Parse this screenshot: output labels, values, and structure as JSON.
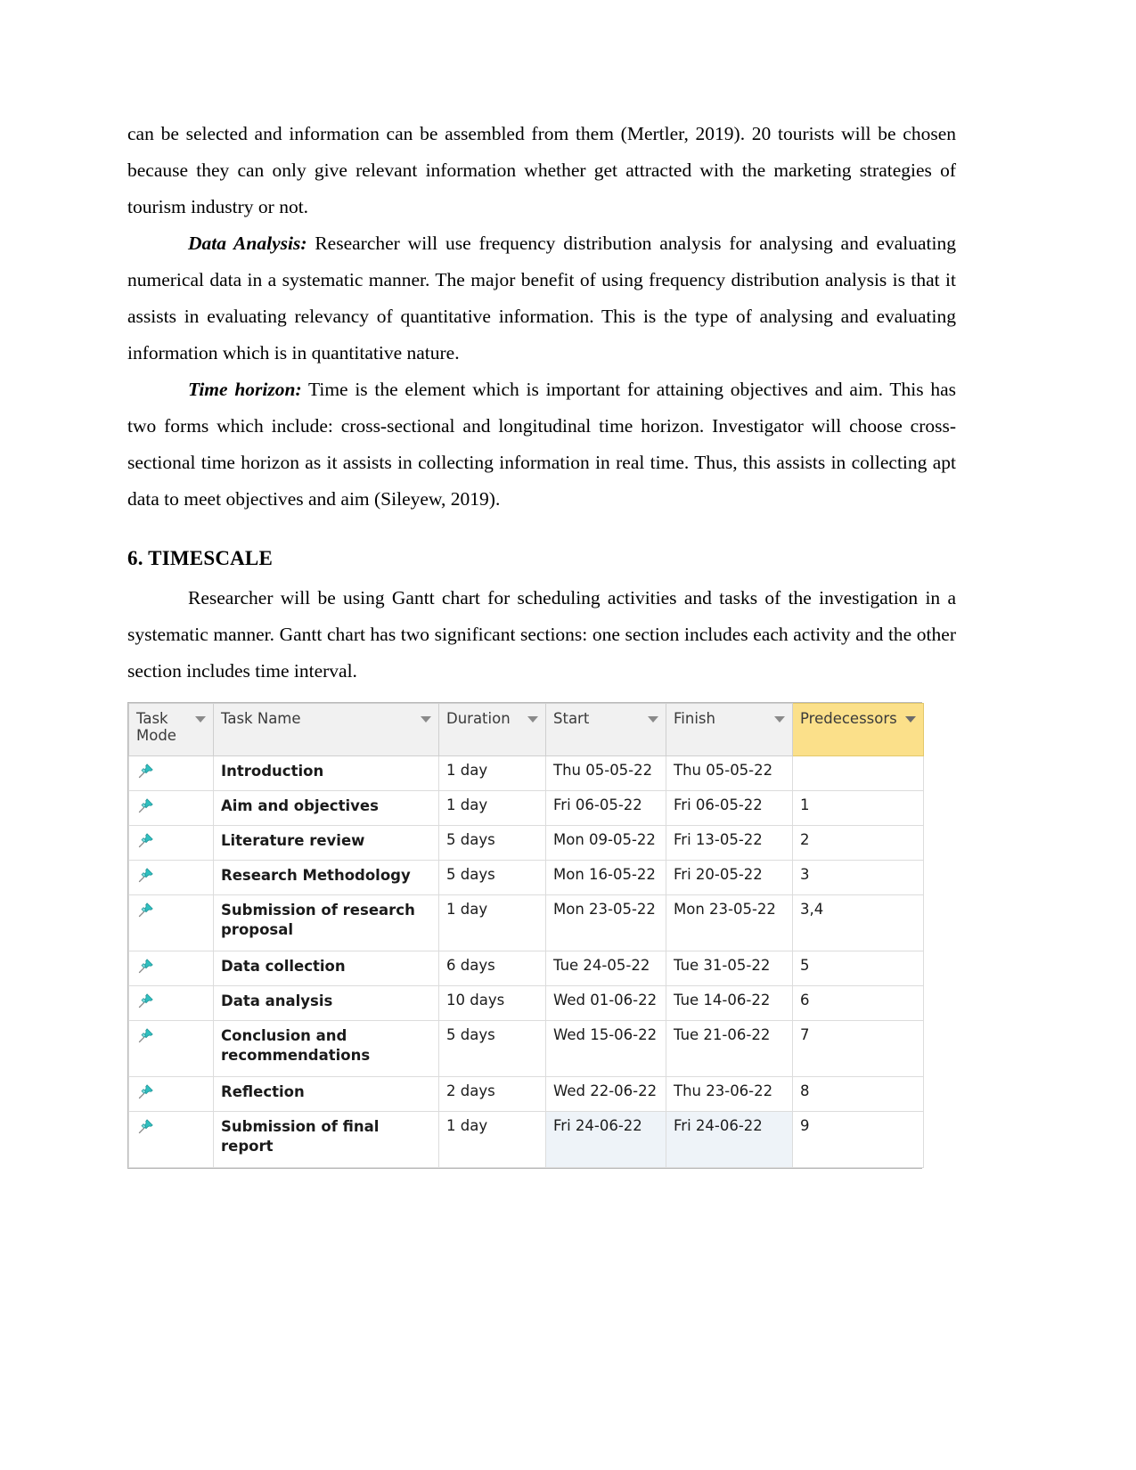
{
  "document": {
    "paragraphs": [
      {
        "id": "p1",
        "text": "can be selected and information can be assembled from them (Mertler, 2019). 20 tourists will be chosen because they can only give relevant information whether get attracted with the marketing strategies of tourism industry or not."
      },
      {
        "id": "p2",
        "lead": "Data Analysis:",
        "text": " Researcher will use frequency distribution analysis for analysing and evaluating numerical data in a systematic manner. The major benefit of using frequency distribution analysis is that it assists in evaluating relevancy of quantitative information. This is the type of analysing and evaluating information which is in quantitative nature."
      },
      {
        "id": "p3",
        "lead": "Time horizon:",
        "text": " Time is the element which is important for attaining objectives and aim. This has two forms which include: cross-sectional and longitudinal time horizon. Investigator will choose cross-sectional time horizon as it assists in collecting information in real time. Thus, this assists in collecting apt data to meet objectives and aim (Sileyew, 2019)."
      }
    ],
    "heading": "6. TIMESCALE",
    "paragraph_after_heading": "Researcher will be using Gantt chart for scheduling activities and tasks of the investigation in a systematic manner. Gantt chart has two significant sections: one section includes each activity and the other section includes time interval."
  },
  "gantt": {
    "columns": [
      {
        "key": "mode",
        "label": "Task Mode",
        "filter_icon": "chevron-down-icon",
        "highlight": false
      },
      {
        "key": "name",
        "label": "Task Name",
        "filter_icon": "chevron-down-icon",
        "highlight": false
      },
      {
        "key": "dur",
        "label": "Duration",
        "filter_icon": "chevron-down-icon",
        "highlight": false
      },
      {
        "key": "start",
        "label": "Start",
        "filter_icon": "chevron-down-icon",
        "highlight": false
      },
      {
        "key": "finish",
        "label": "Finish",
        "filter_icon": "chevron-down-icon",
        "highlight": false
      },
      {
        "key": "pred",
        "label": "Predecessors",
        "filter_icon": "chevron-down-icon",
        "highlight": true
      }
    ],
    "rows": [
      {
        "mode_icon": "pin-icon",
        "name": "Introduction",
        "dur": "1 day",
        "start": "Thu 05-05-22",
        "finish": "Thu 05-05-22",
        "pred": ""
      },
      {
        "mode_icon": "pin-icon",
        "name": "Aim and objectives",
        "dur": "1 day",
        "start": "Fri 06-05-22",
        "finish": "Fri 06-05-22",
        "pred": "1"
      },
      {
        "mode_icon": "pin-icon",
        "name": "Literature review",
        "dur": "5 days",
        "start": "Mon 09-05-22",
        "finish": "Fri 13-05-22",
        "pred": "2"
      },
      {
        "mode_icon": "pin-icon",
        "name": "Research Methodology",
        "dur": "5 days",
        "start": "Mon 16-05-22",
        "finish": "Fri 20-05-22",
        "pred": "3"
      },
      {
        "mode_icon": "pin-icon",
        "name": "Submission of research proposal",
        "dur": "1 day",
        "start": "Mon 23-05-22",
        "finish": "Mon 23-05-22",
        "pred": "3,4"
      },
      {
        "mode_icon": "pin-icon",
        "name": "Data collection",
        "dur": "6 days",
        "start": "Tue 24-05-22",
        "finish": "Tue 31-05-22",
        "pred": "5"
      },
      {
        "mode_icon": "pin-icon",
        "name": "Data analysis",
        "dur": "10 days",
        "start": "Wed 01-06-22",
        "finish": "Tue 14-06-22",
        "pred": "6"
      },
      {
        "mode_icon": "pin-icon",
        "name": "Conclusion and recommendations",
        "dur": "5 days",
        "start": "Wed 15-06-22",
        "finish": "Tue 21-06-22",
        "pred": "7"
      },
      {
        "mode_icon": "pin-icon",
        "name": "Reflection",
        "dur": "2 days",
        "start": "Wed 22-06-22",
        "finish": "Thu 23-06-22",
        "pred": "8"
      },
      {
        "mode_icon": "pin-icon",
        "name": "Submission of final report",
        "dur": "1 day",
        "start": "Fri 24-06-22",
        "finish": "Fri 24-06-22",
        "pred": "9"
      }
    ]
  },
  "colors": {
    "header_bg": "#f1f1f1",
    "predecessor_header_bg": "#fbe08a",
    "grid_line": "#dcdcdc",
    "pin_teal": "#2bb3b3"
  }
}
